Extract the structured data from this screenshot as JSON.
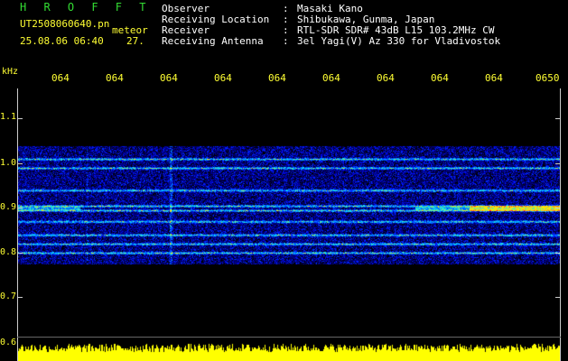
{
  "header": {
    "app_title": "H R O F F T",
    "filename": "UT2508060640.pn",
    "file_type": "meteor",
    "date_time": "25.08.06 06:40",
    "count": "27.",
    "info_rows": [
      {
        "label": "Observer",
        "sep": ":",
        "value": "Masaki Kano"
      },
      {
        "label": "Receiving Location",
        "sep": ":",
        "value": "Shibukawa, Gunma, Japan"
      },
      {
        "label": "Receiver",
        "sep": ":",
        "value": "RTL-SDR SDR# 43dB L15 103.2MHz CW"
      },
      {
        "label": "Receiving Antenna",
        "sep": ":",
        "value": "3el Yagi(V) Az 330 for Vladivostok"
      }
    ]
  },
  "axes": {
    "y_unit": "kHz",
    "y_ticks": [
      "1.1",
      "1.0",
      "0.9",
      "0.8",
      "0.7",
      "0.6"
    ],
    "time_ticks": [
      "064",
      "064",
      "064",
      "064",
      "064",
      "064",
      "064",
      "064",
      "064",
      "0650"
    ]
  },
  "spectrogram": {
    "frequency_range_khz": [
      0.6,
      1.15
    ],
    "signal_lines_khz": [
      1.01,
      0.99,
      0.94,
      0.905,
      0.895,
      0.87,
      0.84,
      0.82,
      0.8
    ],
    "strong_signal_khz": 0.9,
    "colors": {
      "background": "#000000",
      "noise": "#1a2fe0",
      "mid": "#22c8ff",
      "hot": "#ffee00",
      "max": "#ff2222",
      "level_bar": "#ffff00"
    }
  }
}
